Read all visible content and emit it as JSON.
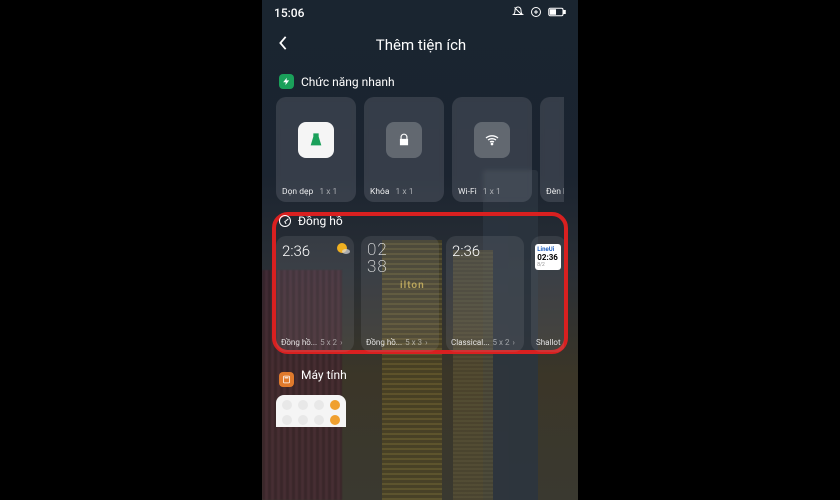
{
  "statusbar": {
    "time": "15:06"
  },
  "header": {
    "title": "Thêm tiện ích"
  },
  "sections": {
    "quick": {
      "title": "Chức năng nhanh",
      "items": [
        {
          "name": "Dọn dẹp",
          "size": "1 x 1"
        },
        {
          "name": "Khóa",
          "size": "1 x 1"
        },
        {
          "name": "Wi-Fi",
          "size": "1 x 1"
        },
        {
          "name": "Đèn Pin",
          "size": ""
        }
      ]
    },
    "clock": {
      "title": "Đồng hồ",
      "items": [
        {
          "name": "Đồng hồ...",
          "size": "5 x 2",
          "time": "2:36"
        },
        {
          "name": "Đồng hồ...",
          "size": "5 x 3",
          "time_l1": "02",
          "time_l2": "38"
        },
        {
          "name": "Classical...",
          "size": "5 x 2",
          "time": "2:36"
        },
        {
          "name": "Shallot",
          "lineui_label": "LineUi",
          "lineui_time": "02:36",
          "lineui_sub": "8/2"
        }
      ]
    },
    "calculator": {
      "title": "Máy tính"
    }
  }
}
